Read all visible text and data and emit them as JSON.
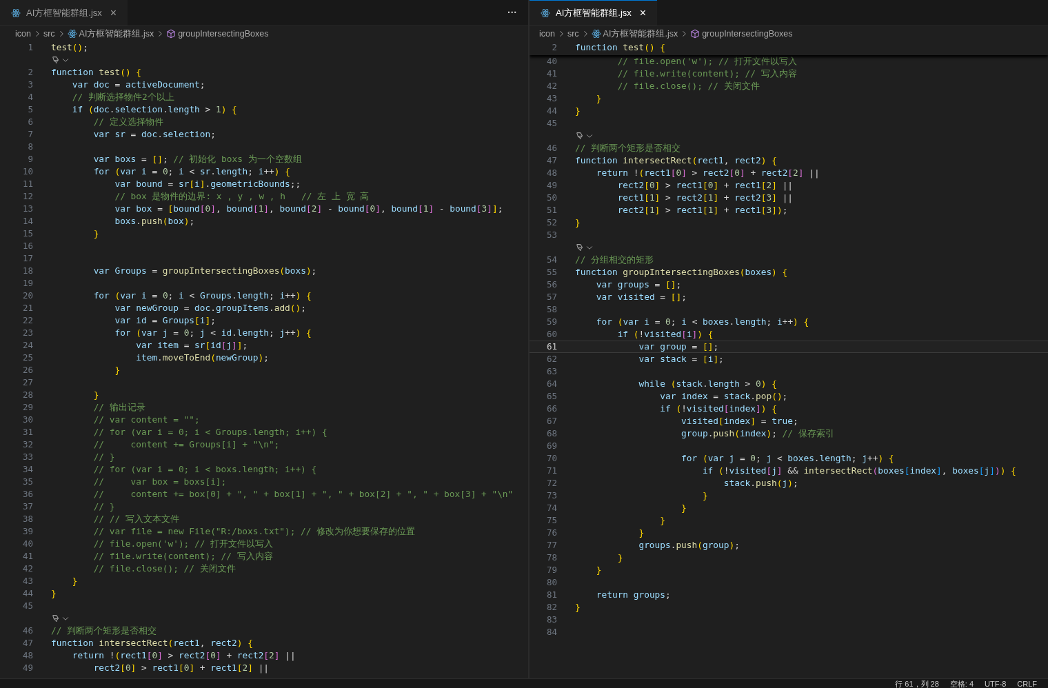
{
  "panes": [
    {
      "focused": false,
      "tab": {
        "label": "AI方框智能群组.jsx",
        "close": "×"
      },
      "more": "···",
      "breadcrumb": [
        "icon",
        "src",
        "AI方框智能群组.jsx",
        "groupIntersectingBoxes"
      ],
      "lines": [
        {
          "kind": "code",
          "n": "1",
          "code": "test();"
        },
        {
          "kind": "codelens"
        },
        {
          "kind": "code",
          "n": "2",
          "code": "function test() {"
        },
        {
          "kind": "code",
          "n": "3",
          "code": "    var doc = activeDocument;"
        },
        {
          "kind": "code",
          "n": "4",
          "comment": "    // 判断选择物件2个以上"
        },
        {
          "kind": "code",
          "n": "5",
          "code": "    if (doc.selection.length > 1) {"
        },
        {
          "kind": "code",
          "n": "6",
          "comment": "        // 定义选择物件"
        },
        {
          "kind": "code",
          "n": "7",
          "code": "        var sr = doc.selection;"
        },
        {
          "kind": "code",
          "n": "8"
        },
        {
          "kind": "code",
          "n": "9",
          "code": "        var boxs = []; ",
          "comment": "// 初始化 boxs 为一个空数组"
        },
        {
          "kind": "code",
          "n": "10",
          "code": "        for (var i = 0; i < sr.length; i++) {"
        },
        {
          "kind": "code",
          "n": "11",
          "code": "            var bound = sr[i].geometricBounds;;"
        },
        {
          "kind": "code",
          "n": "12",
          "comment": "            // box 是物件的边界: x , y , w , h   // 左 上 宽 高"
        },
        {
          "kind": "code",
          "n": "13",
          "code": "            var box = [bound[0], bound[1], bound[2] - bound[0], bound[1] - bound[3]];"
        },
        {
          "kind": "code",
          "n": "14",
          "code": "            boxs.push(box);"
        },
        {
          "kind": "code",
          "n": "15",
          "code": "        }"
        },
        {
          "kind": "code",
          "n": "16"
        },
        {
          "kind": "code",
          "n": "17"
        },
        {
          "kind": "code",
          "n": "18",
          "code": "        var Groups = groupIntersectingBoxes(boxs);"
        },
        {
          "kind": "code",
          "n": "19"
        },
        {
          "kind": "code",
          "n": "20",
          "code": "        for (var i = 0; i < Groups.length; i++) {"
        },
        {
          "kind": "code",
          "n": "21",
          "code": "            var newGroup = doc.groupItems.add();"
        },
        {
          "kind": "code",
          "n": "22",
          "code": "            var id = Groups[i];"
        },
        {
          "kind": "code",
          "n": "23",
          "code": "            for (var j = 0; j < id.length; j++) {"
        },
        {
          "kind": "code",
          "n": "24",
          "code": "                var item = sr[id[j]];"
        },
        {
          "kind": "code",
          "n": "25",
          "code": "                item.moveToEnd(newGroup);"
        },
        {
          "kind": "code",
          "n": "26",
          "code": "            }"
        },
        {
          "kind": "code",
          "n": "27"
        },
        {
          "kind": "code",
          "n": "28",
          "code": "        }"
        },
        {
          "kind": "code",
          "n": "29",
          "comment": "        // 输出记录"
        },
        {
          "kind": "code",
          "n": "30",
          "comment": "        // var content = \"\";"
        },
        {
          "kind": "code",
          "n": "31",
          "comment": "        // for (var i = 0; i < Groups.length; i++) {"
        },
        {
          "kind": "code",
          "n": "32",
          "comment": "        //     content += Groups[i] + \"\\n\";"
        },
        {
          "kind": "code",
          "n": "33",
          "comment": "        // }"
        },
        {
          "kind": "code",
          "n": "34",
          "comment": "        // for (var i = 0; i < boxs.length; i++) {"
        },
        {
          "kind": "code",
          "n": "35",
          "comment": "        //     var box = boxs[i];"
        },
        {
          "kind": "code",
          "n": "36",
          "comment": "        //     content += box[0] + \", \" + box[1] + \", \" + box[2] + \", \" + box[3] + \"\\n\""
        },
        {
          "kind": "code",
          "n": "37",
          "comment": "        // }"
        },
        {
          "kind": "code",
          "n": "38",
          "comment": "        // // 写入文本文件"
        },
        {
          "kind": "code",
          "n": "39",
          "comment": "        // var file = new File(\"R:/boxs.txt\"); // 修改为你想要保存的位置"
        },
        {
          "kind": "code",
          "n": "40",
          "comment": "        // file.open('w'); // 打开文件以写入"
        },
        {
          "kind": "code",
          "n": "41",
          "comment": "        // file.write(content); // 写入内容"
        },
        {
          "kind": "code",
          "n": "42",
          "comment": "        // file.close(); // 关闭文件"
        },
        {
          "kind": "code",
          "n": "43",
          "code": "    }"
        },
        {
          "kind": "code",
          "n": "44",
          "code": "}"
        },
        {
          "kind": "code",
          "n": "45"
        },
        {
          "kind": "codelens"
        },
        {
          "kind": "code",
          "n": "46",
          "comment": "// 判断两个矩形是否相交"
        },
        {
          "kind": "code",
          "n": "47",
          "code": "function intersectRect(rect1, rect2) {"
        },
        {
          "kind": "code",
          "n": "48",
          "code": "    return !(rect1[0] > rect2[0] + rect2[2] ||"
        },
        {
          "kind": "code",
          "n": "49",
          "code": "        rect2[0] > rect1[0] + rect1[2] ||"
        }
      ]
    },
    {
      "focused": true,
      "tab": {
        "label": "AI方框智能群组.jsx",
        "close": "×"
      },
      "breadcrumb": [
        "icon",
        "src",
        "AI方框智能群组.jsx",
        "groupIntersectingBoxes"
      ],
      "sticky": {
        "n": "2",
        "code": "function test() {"
      },
      "lines": [
        {
          "kind": "code",
          "n": "40",
          "comment": "        // file.open('w'); // 打开文件以写入"
        },
        {
          "kind": "code",
          "n": "41",
          "comment": "        // file.write(content); // 写入内容"
        },
        {
          "kind": "code",
          "n": "42",
          "comment": "        // file.close(); // 关闭文件"
        },
        {
          "kind": "code",
          "n": "43",
          "code": "    }"
        },
        {
          "kind": "code",
          "n": "44",
          "code": "}"
        },
        {
          "kind": "code",
          "n": "45"
        },
        {
          "kind": "codelens"
        },
        {
          "kind": "code",
          "n": "46",
          "comment": "// 判断两个矩形是否相交"
        },
        {
          "kind": "code",
          "n": "47",
          "code": "function intersectRect(rect1, rect2) {"
        },
        {
          "kind": "code",
          "n": "48",
          "code": "    return !(rect1[0] > rect2[0] + rect2[2] ||"
        },
        {
          "kind": "code",
          "n": "49",
          "code": "        rect2[0] > rect1[0] + rect1[2] ||"
        },
        {
          "kind": "code",
          "n": "50",
          "code": "        rect1[1] > rect2[1] + rect2[3] ||"
        },
        {
          "kind": "code",
          "n": "51",
          "code": "        rect2[1] > rect1[1] + rect1[3]);"
        },
        {
          "kind": "code",
          "n": "52",
          "code": "}"
        },
        {
          "kind": "code",
          "n": "53"
        },
        {
          "kind": "codelens"
        },
        {
          "kind": "code",
          "n": "54",
          "comment": "// 分组相交的矩形"
        },
        {
          "kind": "code",
          "n": "55",
          "code": "function groupIntersectingBoxes(boxes) {"
        },
        {
          "kind": "code",
          "n": "56",
          "code": "    var groups = [];"
        },
        {
          "kind": "code",
          "n": "57",
          "code": "    var visited = [];"
        },
        {
          "kind": "code",
          "n": "58"
        },
        {
          "kind": "code",
          "n": "59",
          "code": "    for (var i = 0; i < boxes.length; i++) {"
        },
        {
          "kind": "code",
          "n": "60",
          "code": "        if (!visited[i]) {"
        },
        {
          "kind": "code",
          "n": "61",
          "code": "            var group = [];",
          "current": true
        },
        {
          "kind": "code",
          "n": "62",
          "code": "            var stack = [i];"
        },
        {
          "kind": "code",
          "n": "63"
        },
        {
          "kind": "code",
          "n": "64",
          "code": "            while (stack.length > 0) {"
        },
        {
          "kind": "code",
          "n": "65",
          "code": "                var index = stack.pop();"
        },
        {
          "kind": "code",
          "n": "66",
          "code": "                if (!visited[index]) {"
        },
        {
          "kind": "code",
          "n": "67",
          "code": "                    visited[index] = true;"
        },
        {
          "kind": "code",
          "n": "68",
          "code": "                    group.push(index); ",
          "comment": "// 保存索引"
        },
        {
          "kind": "code",
          "n": "69"
        },
        {
          "kind": "code",
          "n": "70",
          "code": "                    for (var j = 0; j < boxes.length; j++) {"
        },
        {
          "kind": "code",
          "n": "71",
          "code": "                        if (!visited[j] && intersectRect(boxes[index], boxes[j])) {"
        },
        {
          "kind": "code",
          "n": "72",
          "code": "                            stack.push(j);"
        },
        {
          "kind": "code",
          "n": "73",
          "code": "                        }"
        },
        {
          "kind": "code",
          "n": "74",
          "code": "                    }"
        },
        {
          "kind": "code",
          "n": "75",
          "code": "                }"
        },
        {
          "kind": "code",
          "n": "76",
          "code": "            }"
        },
        {
          "kind": "code",
          "n": "77",
          "code": "            groups.push(group);"
        },
        {
          "kind": "code",
          "n": "78",
          "code": "        }"
        },
        {
          "kind": "code",
          "n": "79",
          "code": "    }"
        },
        {
          "kind": "code",
          "n": "80"
        },
        {
          "kind": "code",
          "n": "81",
          "code": "    return groups;"
        },
        {
          "kind": "code",
          "n": "82",
          "code": "}"
        },
        {
          "kind": "code",
          "n": "83"
        },
        {
          "kind": "code",
          "n": "84"
        }
      ]
    }
  ],
  "status_bar": [
    "行 61，列 28",
    "空格: 4",
    "UTF-8",
    "CRLF"
  ]
}
